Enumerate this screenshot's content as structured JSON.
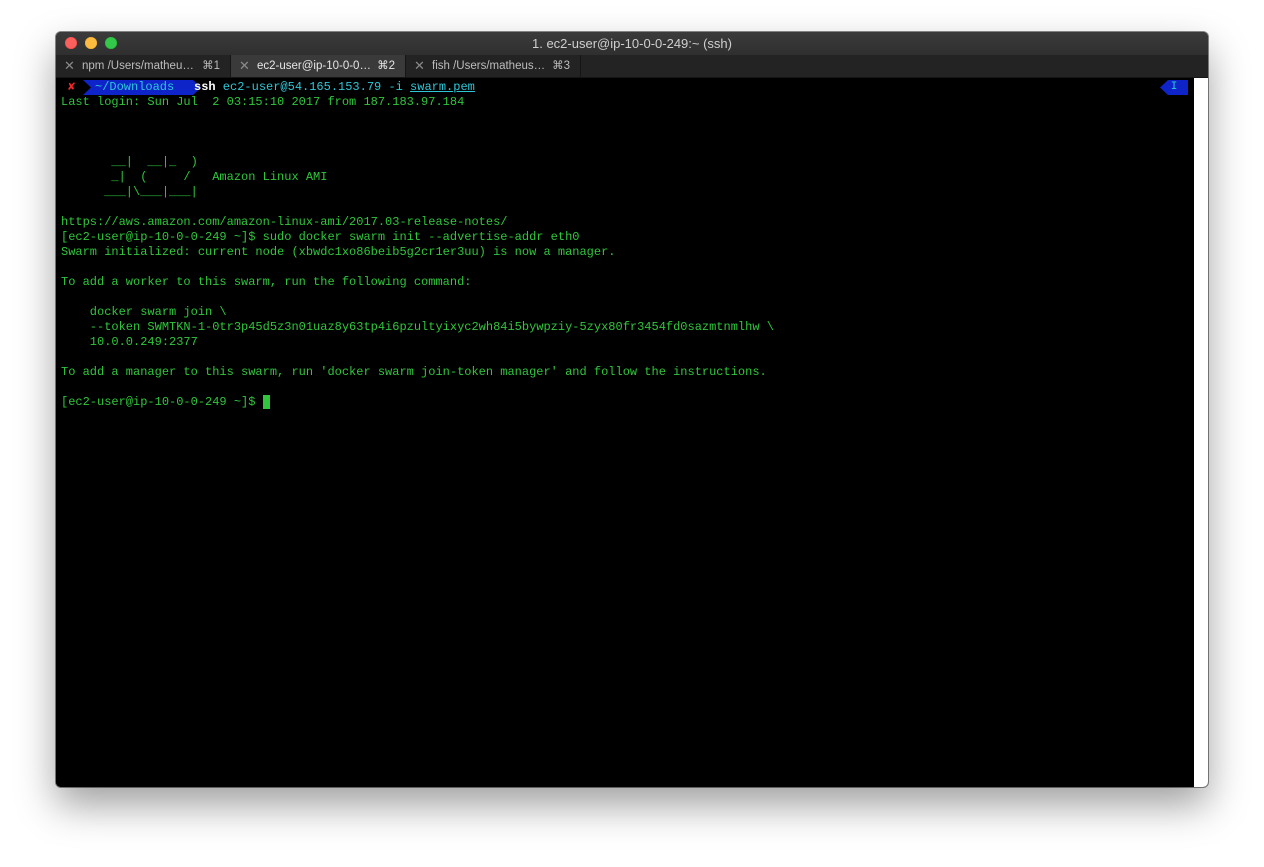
{
  "window": {
    "title": "1. ec2-user@ip-10-0-0-249:~ (ssh)"
  },
  "tabs": [
    {
      "label": "npm  /Users/matheu…",
      "shortcut": "⌘1",
      "active": false
    },
    {
      "label": "ec2-user@ip-10-0-0…",
      "shortcut": "⌘2",
      "active": true
    },
    {
      "label": "fish  /Users/matheus…",
      "shortcut": "⌘3",
      "active": false
    }
  ],
  "prompt": {
    "status_icon": "✘",
    "path": "~/Downloads",
    "command": "ssh",
    "args": " ec2-user@54.165.153.79 -i ",
    "file_arg": "swarm.pem",
    "mode": "I"
  },
  "output": {
    "last_login": "Last login: Sun Jul  2 03:15:10 2017 from 187.183.97.184",
    "banner1": "       __|  __|_  )",
    "banner2": "       _|  (     /   Amazon Linux AMI",
    "banner3": "      ___|\\___|___|",
    "release_notes": "https://aws.amazon.com/amazon-linux-ami/2017.03-release-notes/",
    "cmd_init": "[ec2-user@ip-10-0-0-249 ~]$ sudo docker swarm init --advertise-addr eth0",
    "swarm_initialized": "Swarm initialized: current node (xbwdc1xo86beib5g2cr1er3uu) is now a manager.",
    "add_worker": "To add a worker to this swarm, run the following command:",
    "join_cmd": "    docker swarm join \\",
    "token_line": "    --token SWMTKN-1-0tr3p45d5z3n01uaz8y63tp4i6pzultyixyc2wh84i5bywpziy-5zyx80fr3454fd0sazmtnmlhw \\",
    "addr_line": "    10.0.0.249:2377",
    "add_manager": "To add a manager to this swarm, run 'docker swarm join-token manager' and follow the instructions.",
    "final_prompt": "[ec2-user@ip-10-0-0-249 ~]$ "
  },
  "colors": {
    "terminal_bg": "#000000",
    "text_green": "#2fc63c",
    "text_cyan": "#2ec7d8",
    "segment_blue": "#0f24c8",
    "error_red": "#ef2929"
  }
}
